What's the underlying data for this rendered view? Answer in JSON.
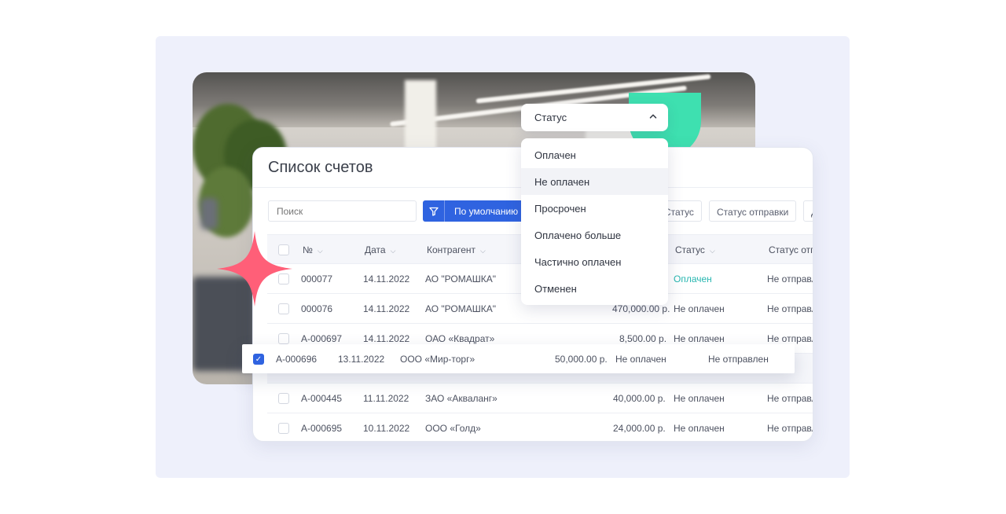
{
  "card": {
    "title": "Список счетов",
    "search_placeholder": "Поиск",
    "filter_label": "По умолчанию",
    "chips": [
      "Статус",
      "Статус отправки",
      "Д"
    ]
  },
  "table": {
    "headers": [
      "№",
      "Дата",
      "Контрагент",
      "Статус",
      "Статус отп"
    ],
    "rows": [
      {
        "num": "000077",
        "date": "14.11.2022",
        "party": "АО \"РОМАШКА\"",
        "amount": "",
        "status": "Оплачен",
        "send": "Не отправл"
      },
      {
        "num": "000076",
        "date": "14.11.2022",
        "party": "АО \"РОМАШКА\"",
        "amount": "470,000.00 р.",
        "status": "Не оплачен",
        "send": "Не отправл"
      },
      {
        "num": "A-000697",
        "date": "14.11.2022",
        "party": "ОАО «Квадрат»",
        "amount": "8,500.00 р.",
        "status": "Не оплачен",
        "send": "Не отправл"
      },
      {
        "num": "A-000445",
        "date": "11.11.2022",
        "party": "ЗАО «Акваланг»",
        "amount": "40,000.00 р.",
        "status": "Не оплачен",
        "send": "Не отправл"
      },
      {
        "num": "A-000695",
        "date": "10.11.2022",
        "party": "ООО «Голд»",
        "amount": "24,000.00 р.",
        "status": "Не оплачен",
        "send": "Не отправл"
      }
    ],
    "selected_row": {
      "num": "A-000696",
      "date": "13.11.2022",
      "party": "ООО «Мир-торг»",
      "amount": "50,000.00 р.",
      "status": "Не оплачен",
      "send": "Не отправлен"
    }
  },
  "status_dropdown": {
    "label": "Статус",
    "options": [
      "Оплачен",
      "Не оплачен",
      "Просрочен",
      "Оплачено больше",
      "Частично оплачен",
      "Отменен"
    ],
    "hovered": "Не оплачен"
  },
  "colors": {
    "accent": "#2f63e0",
    "paid": "#27b6b0",
    "mint": "#3ee0b0",
    "pink": "#ff5f78"
  }
}
